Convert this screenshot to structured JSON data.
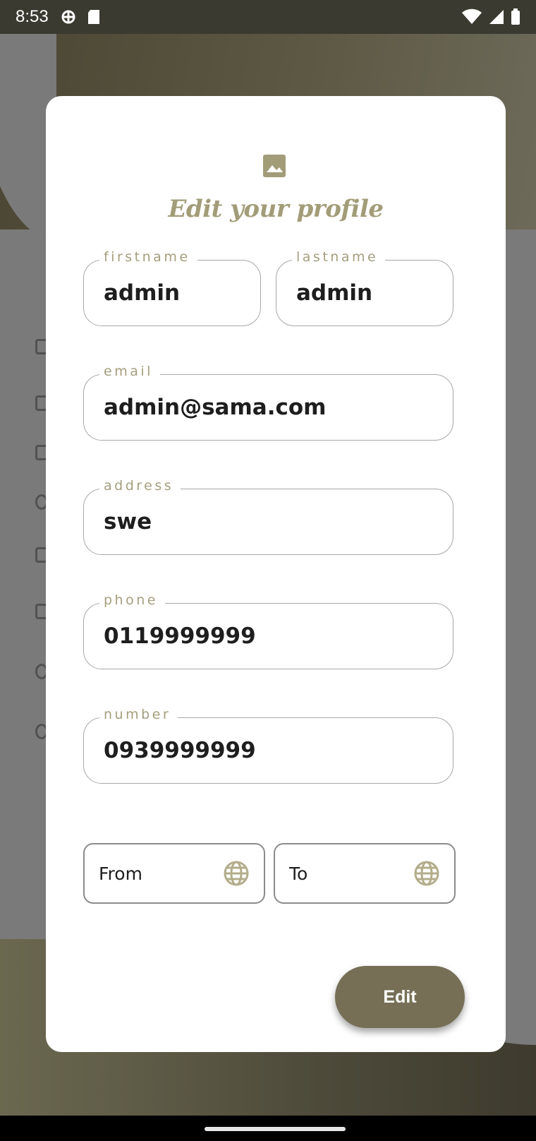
{
  "status_bar": {
    "time": "8:53",
    "icons_left": [
      "vpn-icon",
      "sd-card-icon"
    ],
    "icons_right": [
      "wifi-icon",
      "signal-icon",
      "battery-icon"
    ]
  },
  "dialog": {
    "header_icon": "image-icon",
    "title": "Edit your profile",
    "fields": {
      "firstname": {
        "label": "firstname",
        "value": "admin"
      },
      "lastname": {
        "label": "lastname",
        "value": "admin"
      },
      "email": {
        "label": "email",
        "value": "admin@sama.com"
      },
      "address": {
        "label": "address",
        "value": "swe"
      },
      "phone": {
        "label": "phone",
        "value": "0119999999"
      },
      "number": {
        "label": "number",
        "value": "0939999999"
      }
    },
    "from": {
      "label": "From",
      "icon": "globe-icon"
    },
    "to": {
      "label": "To",
      "icon": "globe-icon"
    },
    "edit_label": "Edit"
  },
  "colors": {
    "accent": "#a49e7d",
    "button": "#766f56",
    "header_bg": "#5c5843"
  }
}
